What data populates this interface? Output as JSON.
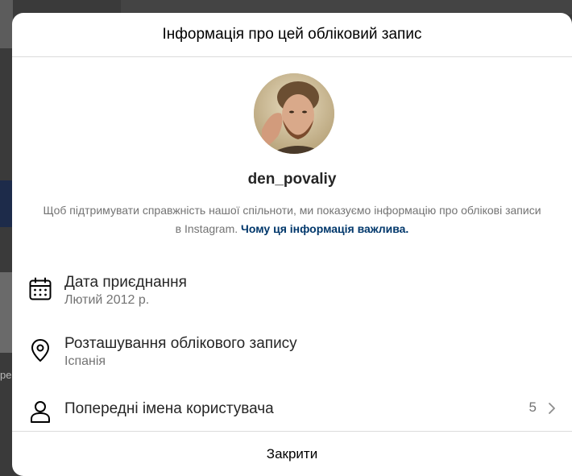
{
  "modal": {
    "title": "Інформація про цей обліковий запис",
    "username": "den_povaliy",
    "description": "Щоб підтримувати справжність нашої спільноти, ми показуємо інформацію про облікові записи в Instagram.",
    "description_link": "Чому ця інформація важлива.",
    "rows": [
      {
        "icon": "calendar-icon",
        "title": "Дата приєднання",
        "subtitle": "Лютий 2012 р."
      },
      {
        "icon": "location-pin-icon",
        "title": "Розташування облікового запису",
        "subtitle": "Іспанія"
      },
      {
        "icon": "user-icon",
        "title": "Попередні імена користувача",
        "count": "5"
      }
    ],
    "close_label": "Закрити"
  },
  "background": {
    "partial_text": "ре"
  },
  "colors": {
    "link": "#00376b",
    "secondary_text": "#737373",
    "divider": "#dbdbdb"
  }
}
